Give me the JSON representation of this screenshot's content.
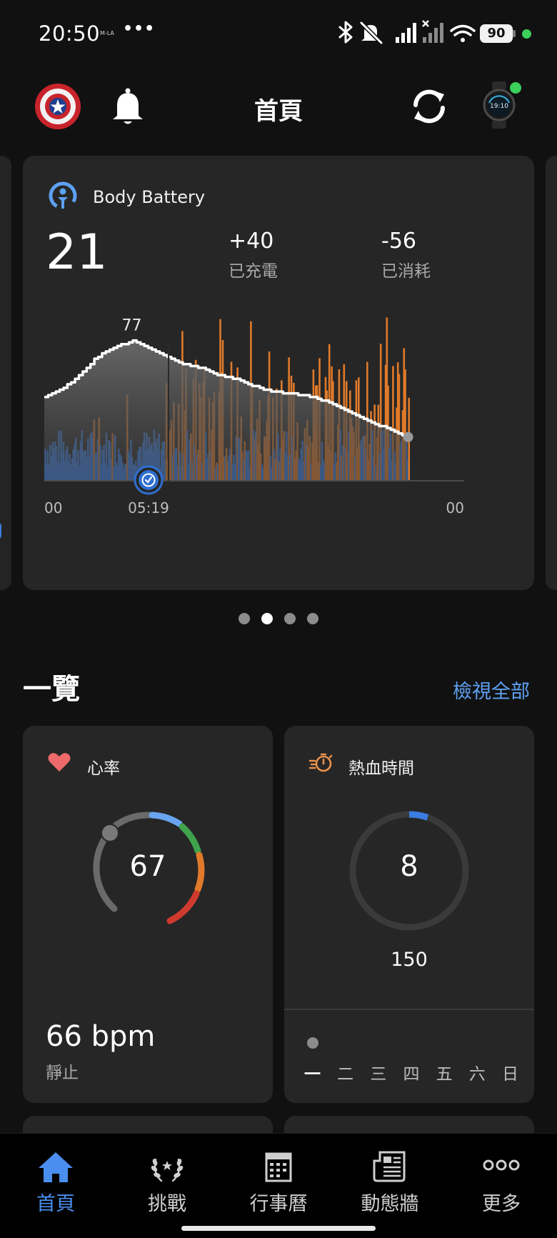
{
  "status_bar": {
    "time": "20:50",
    "tiny_label": "M-LA",
    "more": "•••",
    "battery": "90",
    "icons": [
      "bluetooth-icon",
      "mute-icon",
      "signal-icon",
      "signal-no-service-icon",
      "wifi-icon"
    ]
  },
  "header": {
    "title": "首頁"
  },
  "body_battery": {
    "title": "Body Battery",
    "value": "21",
    "charged_value": "+40",
    "charged_label": "已充電",
    "drained_value": "-56",
    "drained_label": "已消耗",
    "peak_label": "77",
    "x_labels": [
      "00",
      "05:19",
      "00"
    ],
    "colors": {
      "level_line": "#ffffff",
      "stress": "#e07a2a",
      "rest": "#3b7de0",
      "area": "#5a5a5a"
    }
  },
  "chart_data": {
    "type": "area",
    "title": "Body Battery",
    "xlabel": "",
    "ylabel": "",
    "x_ticks": [
      "00",
      "05:19",
      "00"
    ],
    "x": [
      0,
      1,
      2,
      3,
      4,
      5,
      5.3,
      6,
      7,
      8,
      9,
      10,
      11,
      12,
      13,
      14,
      15,
      16,
      17,
      18,
      19,
      20.8
    ],
    "x_unit": "hours since 00:00",
    "ylim": [
      0,
      100
    ],
    "series": [
      {
        "values": [
          46,
          50,
          58,
          68,
          73,
          77,
          76,
          73,
          68,
          64,
          62,
          58,
          56,
          52,
          49,
          48,
          47,
          44,
          40,
          35,
          31,
          24
        ]
      }
    ],
    "peak": 77
  },
  "pager": {
    "count": 4,
    "active": 1
  },
  "overview": {
    "title": "一覽",
    "view_all": "檢視全部"
  },
  "heart_rate": {
    "label": "心率",
    "current": "67",
    "resting": "66 bpm",
    "resting_label": "靜止",
    "zone_colors": [
      "#6aa4f0",
      "#3fa34d",
      "#e07a2a",
      "#d03a2e"
    ]
  },
  "intensity_minutes": {
    "label": "熱血時間",
    "current": "8",
    "goal": "150",
    "progress_fraction": 0.053,
    "days": [
      "一",
      "二",
      "三",
      "四",
      "五",
      "六",
      "日"
    ]
  },
  "nav": {
    "items": [
      {
        "label": "首頁",
        "icon": "home-icon",
        "active": true
      },
      {
        "label": "挑戰",
        "icon": "laurel-icon",
        "active": false
      },
      {
        "label": "行事曆",
        "icon": "calendar-icon",
        "active": false
      },
      {
        "label": "動態牆",
        "icon": "newsfeed-icon",
        "active": false
      },
      {
        "label": "更多",
        "icon": "more-icon",
        "active": false
      }
    ]
  }
}
